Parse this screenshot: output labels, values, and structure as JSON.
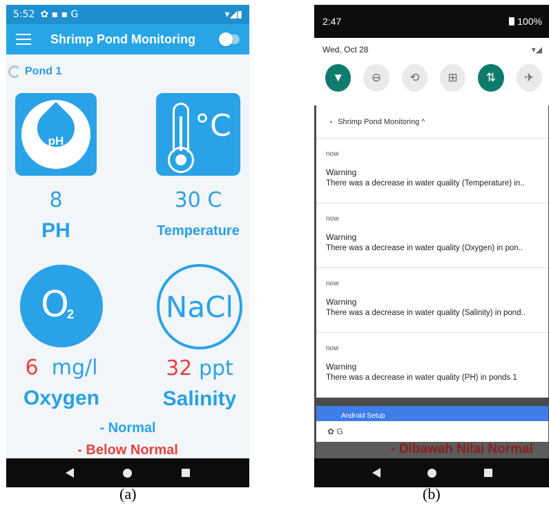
{
  "screen_a": {
    "status": {
      "time": "5:52",
      "icons": "✿ ▪ ▪ G",
      "right_icons": "▾◢▮"
    },
    "app_title": "Shrimp Pond Monitoring",
    "pond_label": "Pond 1",
    "sensors": {
      "ph": {
        "icon_text": "pH",
        "value": "8",
        "label": "PH"
      },
      "temperature": {
        "icon_text": "°C",
        "value": "30 C",
        "label": "Temperature"
      },
      "oxygen": {
        "icon_text": "O",
        "icon_sub": "2",
        "value_num": "6",
        "value_unit": "mg/l",
        "label": "Oxygen",
        "status": "below"
      },
      "salinity": {
        "icon_text": "NaCl",
        "value_num": "32",
        "value_unit": "ppt",
        "label": "Salinity",
        "status": "below"
      }
    },
    "legend": {
      "normal": "- Normal",
      "below": "- Below Normal"
    },
    "colors": {
      "primary": "#28a5e6",
      "warning": "#e5423f"
    }
  },
  "screen_b": {
    "status": {
      "time": "2:47",
      "battery": "100%"
    },
    "date": "Wed, Oct 28",
    "quick_tiles": [
      {
        "icon": "wifi-icon",
        "glyph": "▼",
        "state": "on"
      },
      {
        "icon": "dnd-icon",
        "glyph": "⊖",
        "state": "off"
      },
      {
        "icon": "auto-rotate-icon",
        "glyph": "⟲",
        "state": "off"
      },
      {
        "icon": "battery-saver-icon",
        "glyph": "⊞",
        "state": "off"
      },
      {
        "icon": "data-icon",
        "glyph": "⇅",
        "state": "on"
      },
      {
        "icon": "airplane-icon",
        "glyph": "✈",
        "state": "off"
      }
    ],
    "notification_app": "Shrimp Pond Monitoring ^",
    "notifications": [
      {
        "time": "now",
        "title": "Warning",
        "message": "There was a decrease in water quality (Temperature) in.."
      },
      {
        "time": "now",
        "title": "Warning",
        "message": "There was a decrease in water quality (Oxygen) in pon.."
      },
      {
        "time": "now",
        "title": "Warning",
        "message": "There was a decrease in water quality (Salinity) in pond.."
      },
      {
        "time": "now",
        "title": "Warning",
        "message": "There was a decrease in water quality (PH) in ponds 1"
      }
    ],
    "setup_label": "Android Setup",
    "setup_icons": "✿ G",
    "background_text": "- Dibawah Nilai Normal"
  },
  "captions": {
    "a": "(a)",
    "b": "(b)"
  }
}
